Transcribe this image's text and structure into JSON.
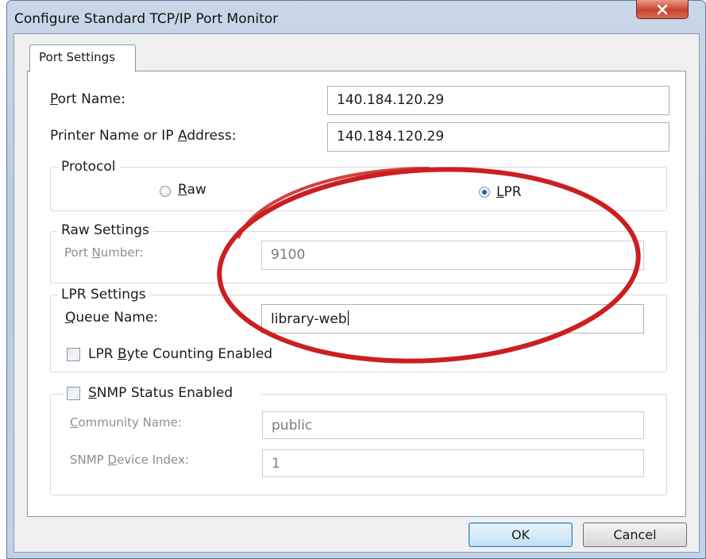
{
  "window": {
    "title": "Configure Standard TCP/IP Port Monitor",
    "close_symbol": "✕"
  },
  "tabs": [
    {
      "label": "Port Settings",
      "selected": true
    }
  ],
  "port_settings": {
    "port_name": {
      "label": "Port Name:",
      "value": "140.184.120.29"
    },
    "printer_address": {
      "label": "Printer Name or IP Address:",
      "value": "140.184.120.29"
    },
    "protocol": {
      "title": "Protocol",
      "options": [
        {
          "label": "Raw",
          "selected": false
        },
        {
          "label": "LPR",
          "selected": true
        }
      ]
    },
    "raw_settings": {
      "title": "Raw Settings",
      "port_number": {
        "label": "Port Number:",
        "value": "9100",
        "enabled": false
      }
    },
    "lpr_settings": {
      "title": "LPR Settings",
      "queue_name": {
        "label": "Queue Name:",
        "value": "library-web"
      },
      "byte_counting": {
        "label": "LPR Byte Counting Enabled",
        "checked": false
      }
    },
    "snmp": {
      "label": "SNMP Status Enabled",
      "checked": false,
      "community_name": {
        "label": "Community Name:",
        "value": "public",
        "enabled": false
      },
      "device_index": {
        "label": "SNMP Device Index:",
        "value": "1",
        "enabled": false
      }
    }
  },
  "buttons": {
    "ok": "OK",
    "cancel": "Cancel"
  },
  "annotation": {
    "shape": "ellipse",
    "color": "#cc1f1f"
  }
}
